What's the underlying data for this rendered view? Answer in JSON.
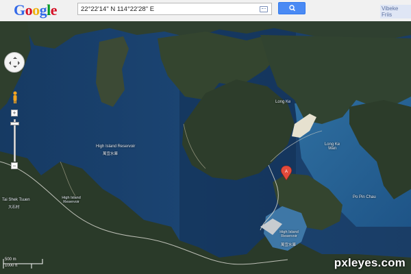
{
  "header": {
    "logo_text": "Google",
    "search_value": "22°22'14\" N 114°22'28\" E",
    "search_button_icon": "search-icon",
    "user_name": "Vibeke Friis"
  },
  "map": {
    "marker_label": "A",
    "labels": {
      "long_ke": "Long Ke",
      "high_island_reservoir_w": "High Island Reservoir",
      "high_island_reservoir_w_cn": "萬宜水庫",
      "long_ke_wan": "Long Ke Wan",
      "high_island_reservoir_c": "High Island Reservoir",
      "tai_shek_tsuen": "Tai Shek Tsuen",
      "tai_shek_tsuen_cn": "大石村",
      "po_pin_chau": "Po Pin Chau",
      "high_island_reservoir_dam": "High Island Reservoir",
      "high_island_reservoir_dam_cn": "萬宜水庫"
    },
    "scale": {
      "metric": "500 m",
      "imperial": "1000 ft"
    }
  },
  "colors": {
    "water_open": "#1a3e6b",
    "land": "#3a4a32",
    "search_button": "#4a8af4"
  },
  "watermark": "pxleyes.com"
}
